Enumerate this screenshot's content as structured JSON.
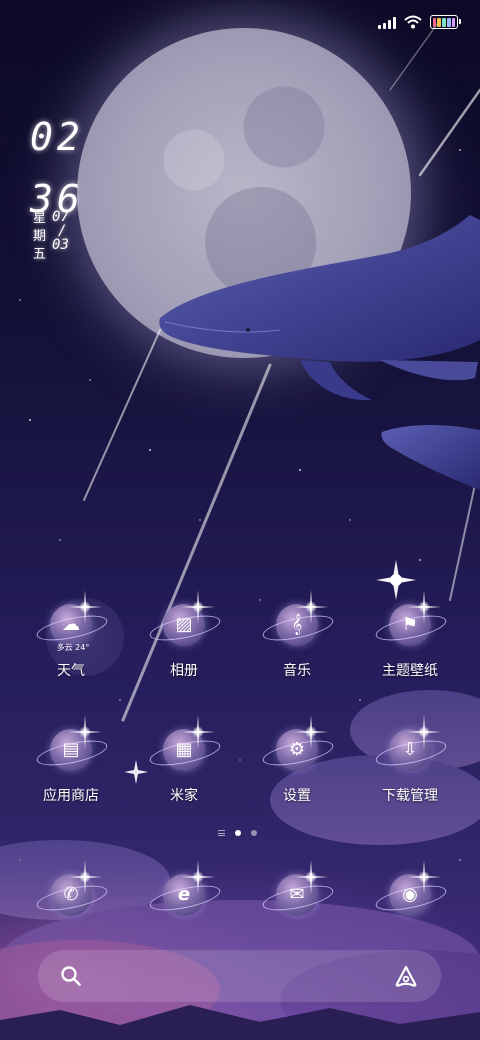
{
  "status_bar": {
    "battery_colors": [
      "#f06a8e",
      "#f3c24f",
      "#7fe0c9",
      "#9fb7ff",
      "#d49bff"
    ]
  },
  "clock": {
    "hour": "02",
    "minute": "36",
    "weekday_chars": [
      "星",
      "期",
      "五"
    ],
    "month": "07",
    "separator": "/",
    "day": "03"
  },
  "apps": [
    {
      "label": "天气",
      "icon": "weather-icon",
      "glyph": "☁"
    },
    {
      "label": "相册",
      "icon": "gallery-icon",
      "glyph": "▨"
    },
    {
      "label": "音乐",
      "icon": "music-icon",
      "glyph": "𝄞"
    },
    {
      "label": "主题壁纸",
      "icon": "theme-flag-icon",
      "glyph": "⚑"
    },
    {
      "label": "应用商店",
      "icon": "app-store-icon",
      "glyph": "▤"
    },
    {
      "label": "米家",
      "icon": "smart-home-gift-icon",
      "glyph": "▦"
    },
    {
      "label": "设置",
      "icon": "settings-gear-icon",
      "glyph": "⚙"
    },
    {
      "label": "下载管理",
      "icon": "download-icon",
      "glyph": "⇩"
    }
  ],
  "weather": {
    "condition": "多云",
    "temperature": "24°"
  },
  "dock": [
    {
      "icon": "phone-icon",
      "glyph": "✆"
    },
    {
      "icon": "browser-icon",
      "glyph": "e"
    },
    {
      "icon": "messages-icon",
      "glyph": "✉"
    },
    {
      "icon": "camera-icon",
      "glyph": "◉"
    }
  ],
  "page_indicator": {
    "pages": 2,
    "current": 1
  },
  "search": {
    "left_icon": "search-icon",
    "right_icon": "assistant-icon"
  }
}
